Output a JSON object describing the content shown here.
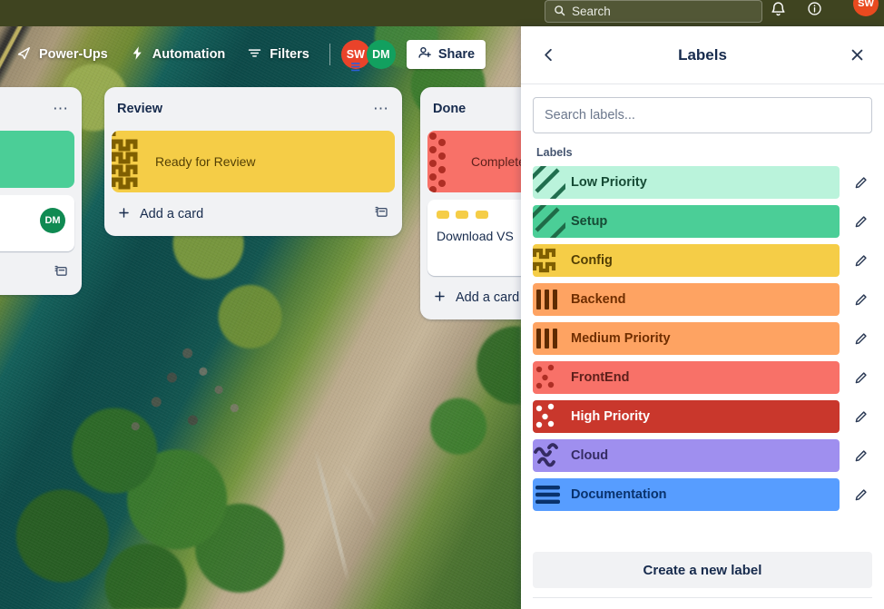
{
  "topbar": {
    "search_placeholder": "Search",
    "search_icon": "search-icon",
    "notifications_icon": "bell-icon",
    "info_icon": "info-icon",
    "avatar_initials": "SW",
    "avatar_color": "#e94a1f",
    "background_color": "#3f4420"
  },
  "board_toolbar": {
    "powerups_label": "Power-Ups",
    "powerups_icon": "rocket-icon",
    "automation_label": "Automation",
    "automation_icon": "lightning-icon",
    "filters_label": "Filters",
    "filters_icon": "filter-icon",
    "share_label": "Share",
    "share_icon": "person-add-icon",
    "members": [
      {
        "initials": "SW",
        "color": "#e9432a",
        "badge": "premium-badge"
      },
      {
        "initials": "DM",
        "color": "#12a05f",
        "badge": ""
      }
    ]
  },
  "board": {
    "lists": [
      {
        "title": "",
        "menu_icon": "list-menu-icon",
        "cards": [
          {
            "title": "",
            "cover_color": "#4bce97",
            "pattern": "",
            "has_cover": true
          },
          {
            "title": "",
            "avatar": "DM",
            "avatar_color": "#108a52",
            "has_cover": false
          }
        ],
        "add_card_label": "",
        "add_card_icon": "plus-icon",
        "template_icon": "card-template-icon"
      },
      {
        "title": "Review",
        "menu_icon": "list-menu-icon",
        "cards": [
          {
            "title": "Ready for Review",
            "cover_color": "#f5cd47",
            "pattern": "zigzag",
            "text_color": "#533f04",
            "has_cover": true
          }
        ],
        "add_card_label": "Add a card",
        "add_card_icon": "plus-icon",
        "template_icon": "card-template-icon"
      },
      {
        "title": "Done",
        "menu_icon": "list-menu-icon",
        "cards": [
          {
            "title": "Complete",
            "cover_color": "#f87168",
            "pattern": "dots",
            "text_color": "#5d1f1a",
            "has_cover": true
          },
          {
            "title": "Download VS",
            "label_color": "#f5cd47",
            "label_pattern": "zigzag",
            "has_cover": false
          }
        ],
        "add_card_label": "Add a card",
        "add_card_icon": "plus-icon",
        "template_icon": "card-template-icon"
      }
    ]
  },
  "panel": {
    "back_icon": "chevron-left-icon",
    "title": "Labels",
    "close_icon": "close-icon",
    "search_placeholder": "Search labels...",
    "search_value": "",
    "section_title": "Labels",
    "edit_icon": "pencil-icon",
    "create_label": "Create a new label",
    "labels": [
      {
        "name": "Low Priority",
        "color": "#baf3db",
        "text_color": "#164b35",
        "pattern": "diagonal",
        "pattern_color": "#216e4e"
      },
      {
        "name": "Setup",
        "color": "#4bce97",
        "text_color": "#164b35",
        "pattern": "diagonal",
        "pattern_color": "#1f6b48"
      },
      {
        "name": "Config",
        "color": "#f5cd47",
        "text_color": "#533f04",
        "pattern": "zigzag",
        "pattern_color": "#7f5f01"
      },
      {
        "name": "Backend",
        "color": "#fea362",
        "text_color": "#702e00",
        "pattern": "bars",
        "pattern_color": "#5f2b00"
      },
      {
        "name": "Medium Priority",
        "color": "#fea362",
        "text_color": "#702e00",
        "pattern": "bars",
        "pattern_color": "#5f2b00"
      },
      {
        "name": "FrontEnd",
        "color": "#f87168",
        "text_color": "#5d1f1a",
        "pattern": "dots",
        "pattern_color": "#ae2e24"
      },
      {
        "name": "High Priority",
        "color": "#c9372c",
        "text_color": "#ffffff",
        "pattern": "dots",
        "pattern_color": "#ffffff"
      },
      {
        "name": "Cloud",
        "color": "#9f8fef",
        "text_color": "#352c63",
        "pattern": "squiggle",
        "pattern_color": "#352c63"
      },
      {
        "name": "Documentation",
        "color": "#579dff",
        "text_color": "#09326c",
        "pattern": "lines",
        "pattern_color": "#09326c"
      }
    ]
  }
}
